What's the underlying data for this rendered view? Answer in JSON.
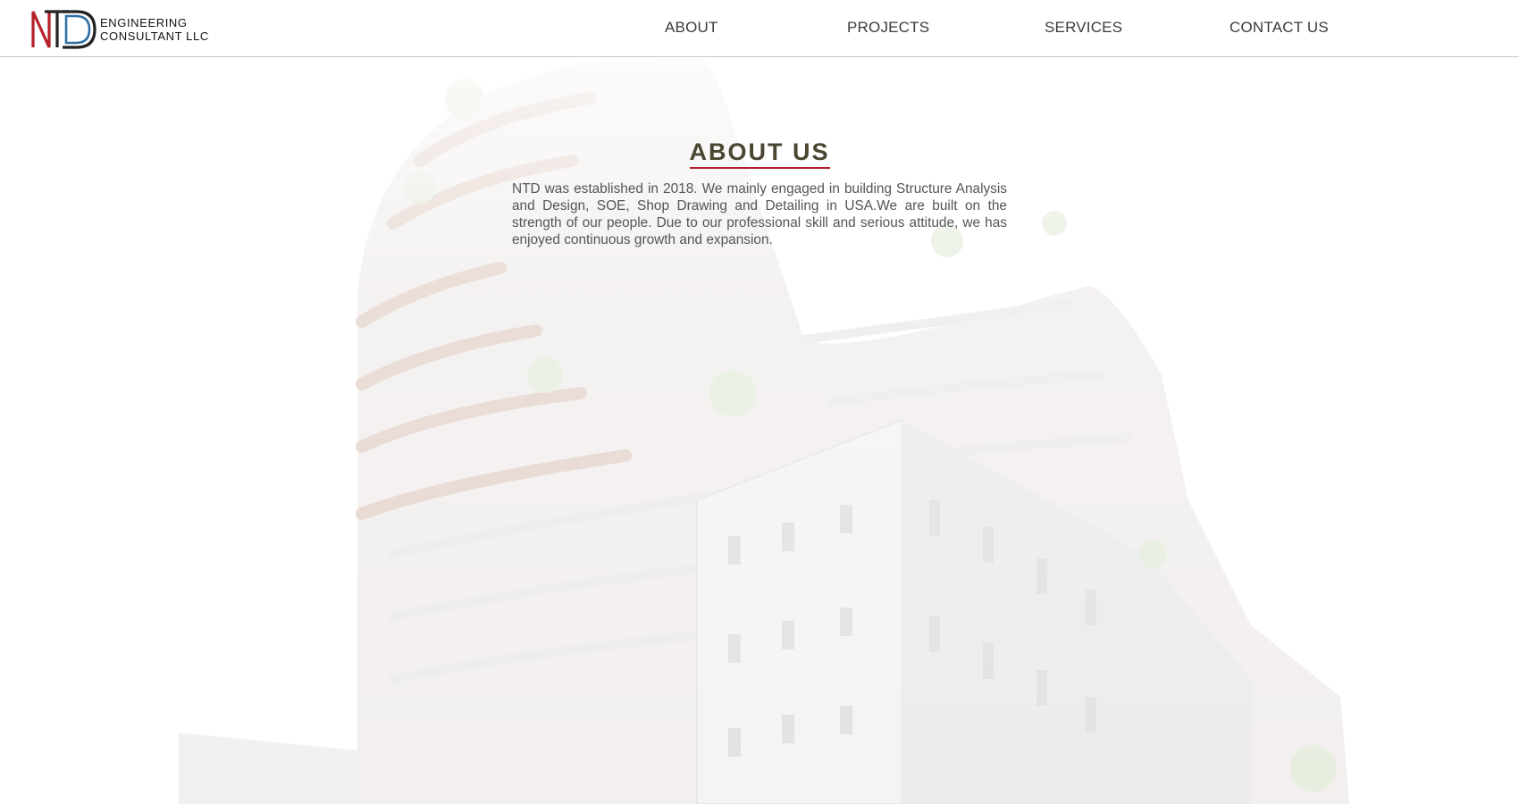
{
  "brand": {
    "logo_letters": "NTD",
    "line1": "ENGINEERING",
    "line2": "CONSULTANT LLC",
    "colors": {
      "n": "#b5202a",
      "t": "#222222",
      "d": "#2f6fa3"
    }
  },
  "nav": {
    "items": [
      {
        "label": "ABOUT"
      },
      {
        "label": "PROJECTS"
      },
      {
        "label": "SERVICES"
      },
      {
        "label": "CONTACT US"
      }
    ]
  },
  "about": {
    "title": "ABOUT US",
    "body": "NTD was established in 2018. We mainly engaged in building Structure Analysis and Design, SOE, Shop Drawing and Detailing in USA.We are built on the strength of our people. Due to our professional skill and serious attitude, we has enjoyed continuous growth and expansion."
  },
  "colors": {
    "accent_underline": "#b5202a",
    "title": "#4a4632",
    "body_text": "#555555",
    "nav_text": "#3b3b3b"
  }
}
